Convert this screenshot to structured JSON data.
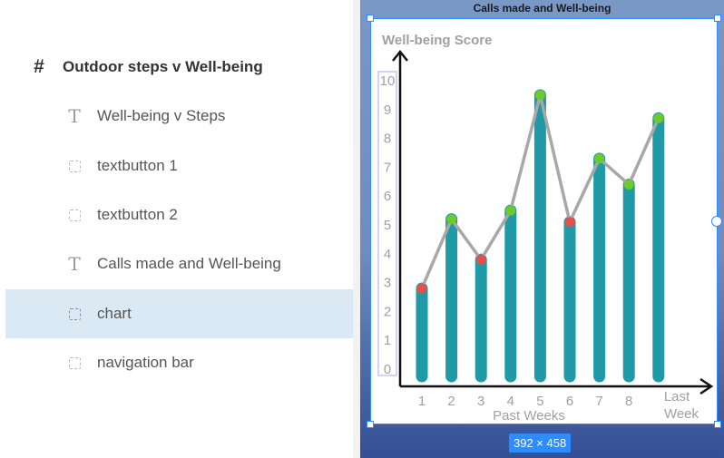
{
  "layers": {
    "frame": {
      "label": "Outdoor steps v Well-being",
      "icon": "frame-hash-icon"
    },
    "items": [
      {
        "label": "Well-being v Steps",
        "icon": "text-icon",
        "kind": "text"
      },
      {
        "label": "textbutton 1",
        "icon": "dashed-frame-icon",
        "kind": "group"
      },
      {
        "label": "textbutton 2",
        "icon": "dashed-frame-icon",
        "kind": "group"
      },
      {
        "label": "Calls made and Well-being",
        "icon": "text-icon",
        "kind": "text"
      },
      {
        "label": "chart",
        "icon": "dashed-frame-icon",
        "kind": "group",
        "selected": true
      },
      {
        "label": "navigation bar",
        "icon": "dashed-frame-icon",
        "kind": "group"
      }
    ]
  },
  "canvas": {
    "frame_title": "Calls made and Well-being",
    "size_badge": "392 × 458",
    "selection_color": "#2d8cff"
  },
  "chart_data": {
    "type": "bar",
    "ylabel": "Well-being Score",
    "xlabel": "Past Weeks",
    "categories": [
      "1",
      "2",
      "3",
      "4",
      "5",
      "6",
      "7",
      "8",
      "Last Week"
    ],
    "y_ticks": [
      "0",
      "1",
      "2",
      "3",
      "4",
      "5",
      "6",
      "7",
      "8",
      "9",
      "10"
    ],
    "ylim": [
      0,
      10
    ],
    "values": [
      2.8,
      5.2,
      3.8,
      5.5,
      9.5,
      5.1,
      7.3,
      6.4,
      8.7
    ],
    "markers": [
      "red",
      "green",
      "red",
      "green",
      "green",
      "red",
      "green",
      "green",
      "green"
    ],
    "colors": {
      "bar": "#1f9aa6",
      "line": "#a8a8a8",
      "up": "#6ccb2a",
      "down": "#e5504d",
      "label": "#a0a0a0"
    }
  }
}
